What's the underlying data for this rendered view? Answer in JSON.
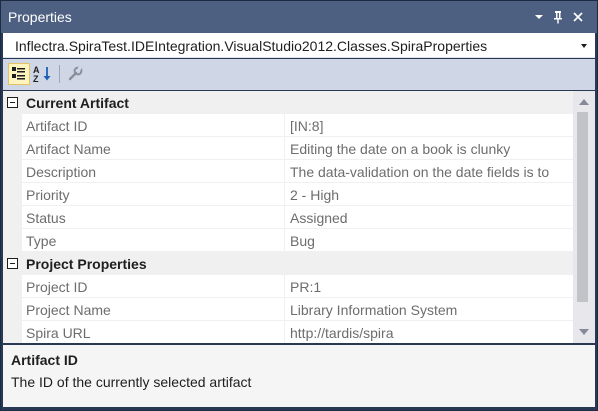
{
  "window": {
    "title": "Properties",
    "controls": {
      "dropdown_icon": "chevron-down-icon",
      "pin_icon": "pin-icon",
      "close_icon": "close-icon"
    }
  },
  "object_selector": {
    "value": "Inflectra.SpiraTest.IDEIntegration.VisualStudio2012.Classes.SpiraProperties"
  },
  "toolbar": {
    "buttons": [
      {
        "name": "categorized",
        "icon": "categorized-icon",
        "active": true
      },
      {
        "name": "alphabetical",
        "icon": "sort-alphabetical-icon",
        "active": false
      },
      {
        "name": "property-pages",
        "icon": "wrench-icon",
        "active": false
      }
    ]
  },
  "grid": {
    "categories": [
      {
        "label": "Current Artifact",
        "expanded": true,
        "properties": [
          {
            "name": "Artifact ID",
            "value": "[IN:8]"
          },
          {
            "name": "Artifact Name",
            "value": "Editing the date on a book is clunky"
          },
          {
            "name": "Description",
            "value": "The data-validation on the date fields is to"
          },
          {
            "name": "Priority",
            "value": "2 - High"
          },
          {
            "name": "Status",
            "value": "Assigned"
          },
          {
            "name": "Type",
            "value": "Bug"
          }
        ]
      },
      {
        "label": "Project Properties",
        "expanded": true,
        "properties": [
          {
            "name": "Project ID",
            "value": "PR:1"
          },
          {
            "name": "Project Name",
            "value": "Library Information System"
          },
          {
            "name": "Spira URL",
            "value": "http://tardis/spira"
          }
        ]
      }
    ]
  },
  "description_pane": {
    "title": "Artifact ID",
    "text": "The ID of the currently selected artifact"
  },
  "colors": {
    "titlebar": "#4d6082",
    "toolbar": "#cfd6e5",
    "category_row": "#f0f0f0",
    "property_text": "#6d6d6d",
    "active_button": "#fdf4bf"
  }
}
